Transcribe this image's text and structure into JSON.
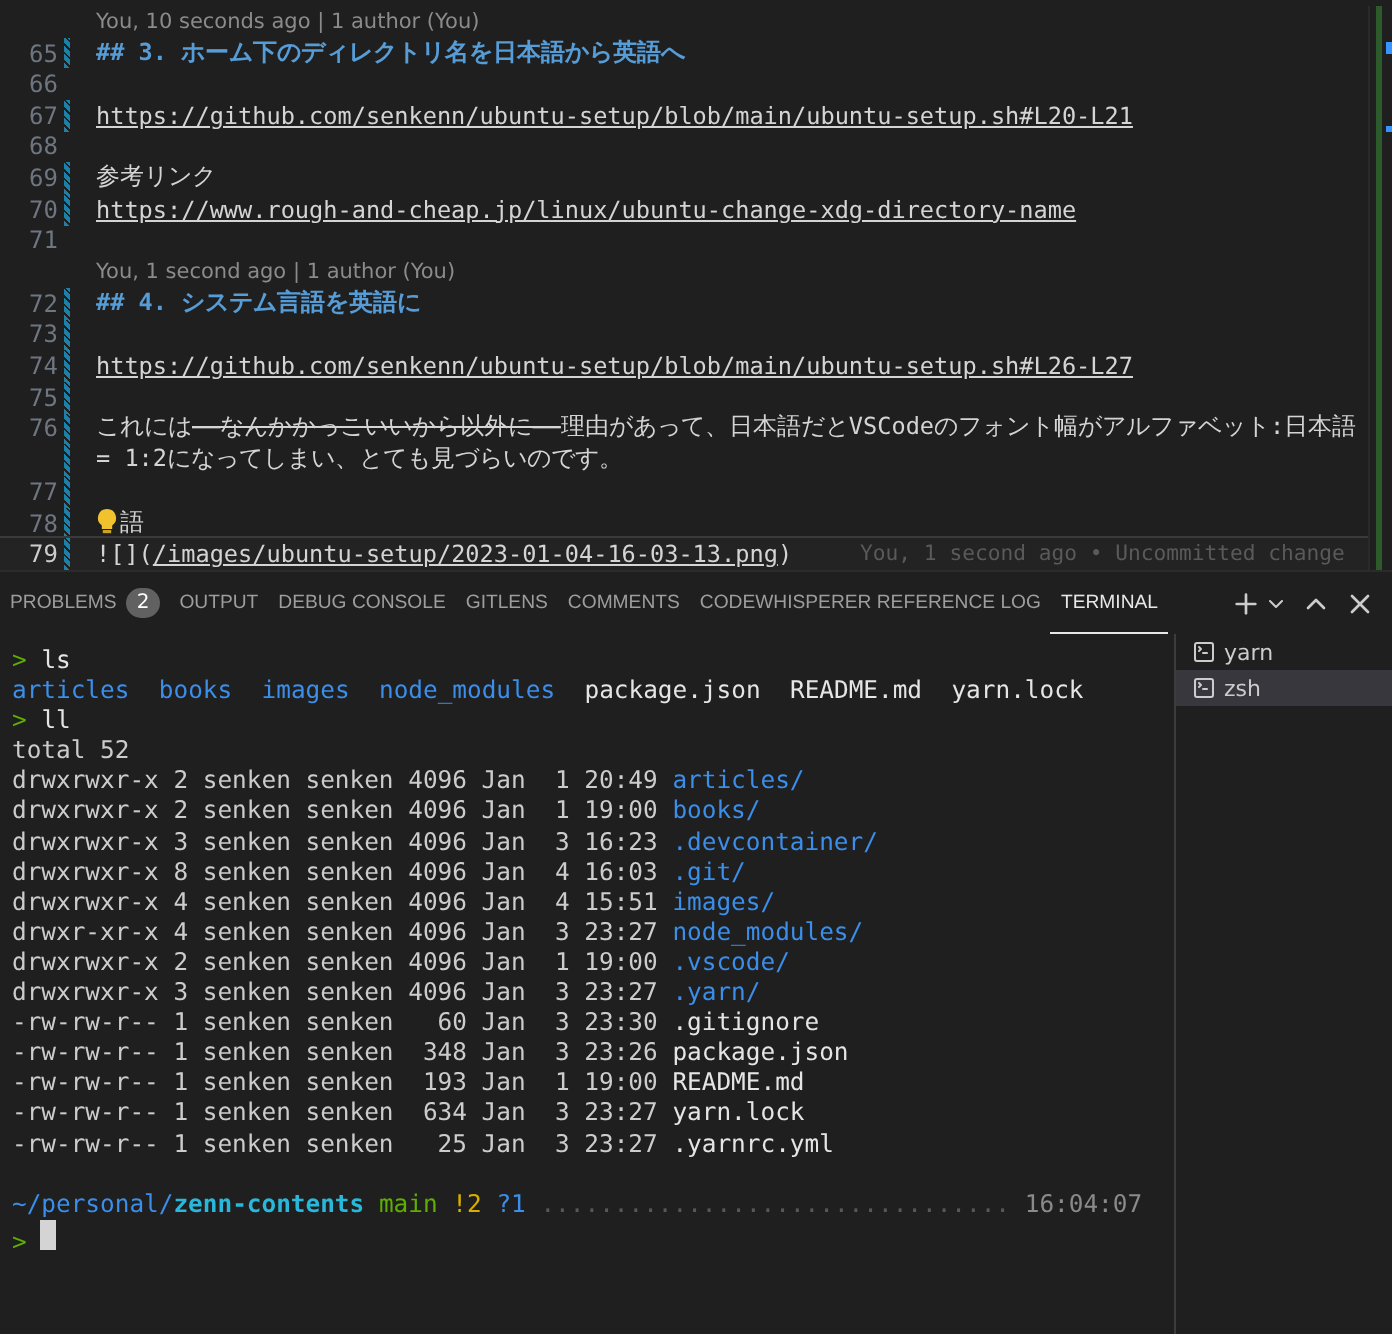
{
  "editor": {
    "rows": [
      {
        "kind": "blame",
        "text": "You, 10 seconds ago | 1 author (You)"
      },
      {
        "kind": "line",
        "number": "65",
        "changed": true,
        "parts": [
          {
            "kind": "heading",
            "text": "## 3. ホーム下のディレクトリ名を日本語から英語へ"
          }
        ]
      },
      {
        "kind": "line",
        "number": "66",
        "changed": false,
        "parts": []
      },
      {
        "kind": "line",
        "number": "67",
        "changed": true,
        "parts": [
          {
            "kind": "link",
            "text": "https://github.com/senkenn/ubuntu-setup/blob/main/ubuntu-setup.sh#L20-L21"
          }
        ]
      },
      {
        "kind": "line",
        "number": "68",
        "changed": false,
        "parts": []
      },
      {
        "kind": "line",
        "number": "69",
        "changed": true,
        "parts": [
          {
            "kind": "plain",
            "text": "参考リンク"
          }
        ]
      },
      {
        "kind": "line",
        "number": "70",
        "changed": true,
        "parts": [
          {
            "kind": "link",
            "text": "https://www.rough-and-cheap.jp/linux/ubuntu-change-xdg-directory-name"
          }
        ]
      },
      {
        "kind": "line",
        "number": "71",
        "changed": false,
        "parts": []
      },
      {
        "kind": "blame",
        "text": "You, 1 second ago | 1 author (You)"
      },
      {
        "kind": "line",
        "number": "72",
        "changed": true,
        "parts": [
          {
            "kind": "heading",
            "text": "## 4. システム言語を英語に"
          }
        ]
      },
      {
        "kind": "line",
        "number": "73",
        "changed": true,
        "parts": []
      },
      {
        "kind": "line",
        "number": "74",
        "changed": true,
        "parts": [
          {
            "kind": "link",
            "text": "https://github.com/senkenn/ubuntu-setup/blob/main/ubuntu-setup.sh#L26-L27"
          }
        ]
      },
      {
        "kind": "line",
        "number": "75",
        "changed": true,
        "parts": []
      },
      {
        "kind": "line",
        "number": "76",
        "changed": true,
        "parts": [
          {
            "kind": "plain",
            "text": "これには"
          },
          {
            "kind": "strike",
            "text": "――なんかかっこいいから以外に――"
          },
          {
            "kind": "plain",
            "text": "理由があって、日本語だとVSCodeのフォント幅がアルファベット:日本語"
          }
        ]
      },
      {
        "kind": "wrap",
        "changed": true,
        "parts": [
          {
            "kind": "plain",
            "text": "= 1:2になってしまい、とても見づらいのです。"
          }
        ]
      },
      {
        "kind": "line",
        "number": "77",
        "changed": true,
        "parts": []
      },
      {
        "kind": "line",
        "number": "78",
        "changed": true,
        "bulb": true,
        "parts": [
          {
            "kind": "plain",
            "text": "語"
          }
        ]
      },
      {
        "kind": "line",
        "number": "79",
        "changed": true,
        "current": true,
        "parts": [
          {
            "kind": "plain",
            "text": "![]("
          },
          {
            "kind": "link",
            "text": "/images/ubuntu-setup/2023-01-04-16-03-13.png"
          },
          {
            "kind": "plain",
            "text": ")"
          }
        ],
        "ghost": "You, 1 second ago • Uncommitted change"
      }
    ]
  },
  "panel": {
    "tabs": [
      {
        "label": "PROBLEMS",
        "badge": "2",
        "selected": false
      },
      {
        "label": "OUTPUT",
        "selected": false
      },
      {
        "label": "DEBUG CONSOLE",
        "selected": false
      },
      {
        "label": "GITLENS",
        "selected": false
      },
      {
        "label": "COMMENTS",
        "selected": false
      },
      {
        "label": "CODEWHISPERER REFERENCE LOG",
        "selected": false
      },
      {
        "label": "TERMINAL",
        "selected": true
      }
    ]
  },
  "terminal": {
    "lines": [
      {
        "kind": "prompt",
        "mark": ">",
        "command": "ls"
      },
      {
        "kind": "ls",
        "items": [
          {
            "name": "articles",
            "kind": "dir"
          },
          {
            "name": "books",
            "kind": "dir"
          },
          {
            "name": "images",
            "kind": "dir"
          },
          {
            "name": "node_modules",
            "kind": "dir"
          },
          {
            "name": "package.json",
            "kind": "file"
          },
          {
            "name": "README.md",
            "kind": "file"
          },
          {
            "name": "yarn.lock",
            "kind": "file"
          }
        ]
      },
      {
        "kind": "prompt",
        "mark": ">",
        "command": "ll"
      },
      {
        "kind": "text",
        "text": "total 52"
      },
      {
        "kind": "entry",
        "info": "drwxrwxr-x 2 senken senken 4096 Jan  1 20:49",
        "file": {
          "name": "articles/",
          "kind": "dir"
        }
      },
      {
        "kind": "entry",
        "info": "drwxrwxr-x 2 senken senken 4096 Jan  1 19:00",
        "file": {
          "name": "books/",
          "kind": "dir"
        }
      },
      {
        "kind": "entry",
        "info": "drwxrwxr-x 3 senken senken 4096 Jan  3 16:23",
        "file": {
          "name": ".devcontainer/",
          "kind": "dir"
        }
      },
      {
        "kind": "entry",
        "info": "drwxrwxr-x 8 senken senken 4096 Jan  4 16:03",
        "file": {
          "name": ".git/",
          "kind": "dir"
        }
      },
      {
        "kind": "entry",
        "info": "drwxrwxr-x 4 senken senken 4096 Jan  4 15:51",
        "file": {
          "name": "images/",
          "kind": "dir"
        }
      },
      {
        "kind": "entry",
        "info": "drwxr-xr-x 4 senken senken 4096 Jan  3 23:27",
        "file": {
          "name": "node_modules/",
          "kind": "dir"
        }
      },
      {
        "kind": "entry",
        "info": "drwxrwxr-x 2 senken senken 4096 Jan  1 19:00",
        "file": {
          "name": ".vscode/",
          "kind": "dir"
        }
      },
      {
        "kind": "entry",
        "info": "drwxrwxr-x 3 senken senken 4096 Jan  3 23:27",
        "file": {
          "name": ".yarn/",
          "kind": "dir"
        }
      },
      {
        "kind": "entry",
        "info": "-rw-rw-r-- 1 senken senken   60 Jan  3 23:30",
        "file": {
          "name": ".gitignore",
          "kind": "file"
        }
      },
      {
        "kind": "entry",
        "info": "-rw-rw-r-- 1 senken senken  348 Jan  3 23:26",
        "file": {
          "name": "package.json",
          "kind": "file"
        }
      },
      {
        "kind": "entry",
        "info": "-rw-rw-r-- 1 senken senken  193 Jan  1 19:00",
        "file": {
          "name": "README.md",
          "kind": "file"
        }
      },
      {
        "kind": "entry",
        "info": "-rw-rw-r-- 1 senken senken  634 Jan  3 23:27",
        "file": {
          "name": "yarn.lock",
          "kind": "file"
        }
      },
      {
        "kind": "entry",
        "info": "-rw-rw-r-- 1 senken senken   25 Jan  3 23:27",
        "file": {
          "name": ".yarnrc.yml",
          "kind": "file"
        }
      },
      {
        "kind": "blank"
      },
      {
        "kind": "status",
        "path": "~/personal/",
        "repo": "zenn-contents",
        "branch": "main",
        "modified": "!2",
        "untracked": "?1",
        "dots": "................................",
        "time": "16:04:07"
      },
      {
        "kind": "input",
        "mark": ">"
      }
    ],
    "sessions": [
      {
        "label": "yarn",
        "selected": false
      },
      {
        "label": "zsh",
        "selected": true
      }
    ]
  }
}
